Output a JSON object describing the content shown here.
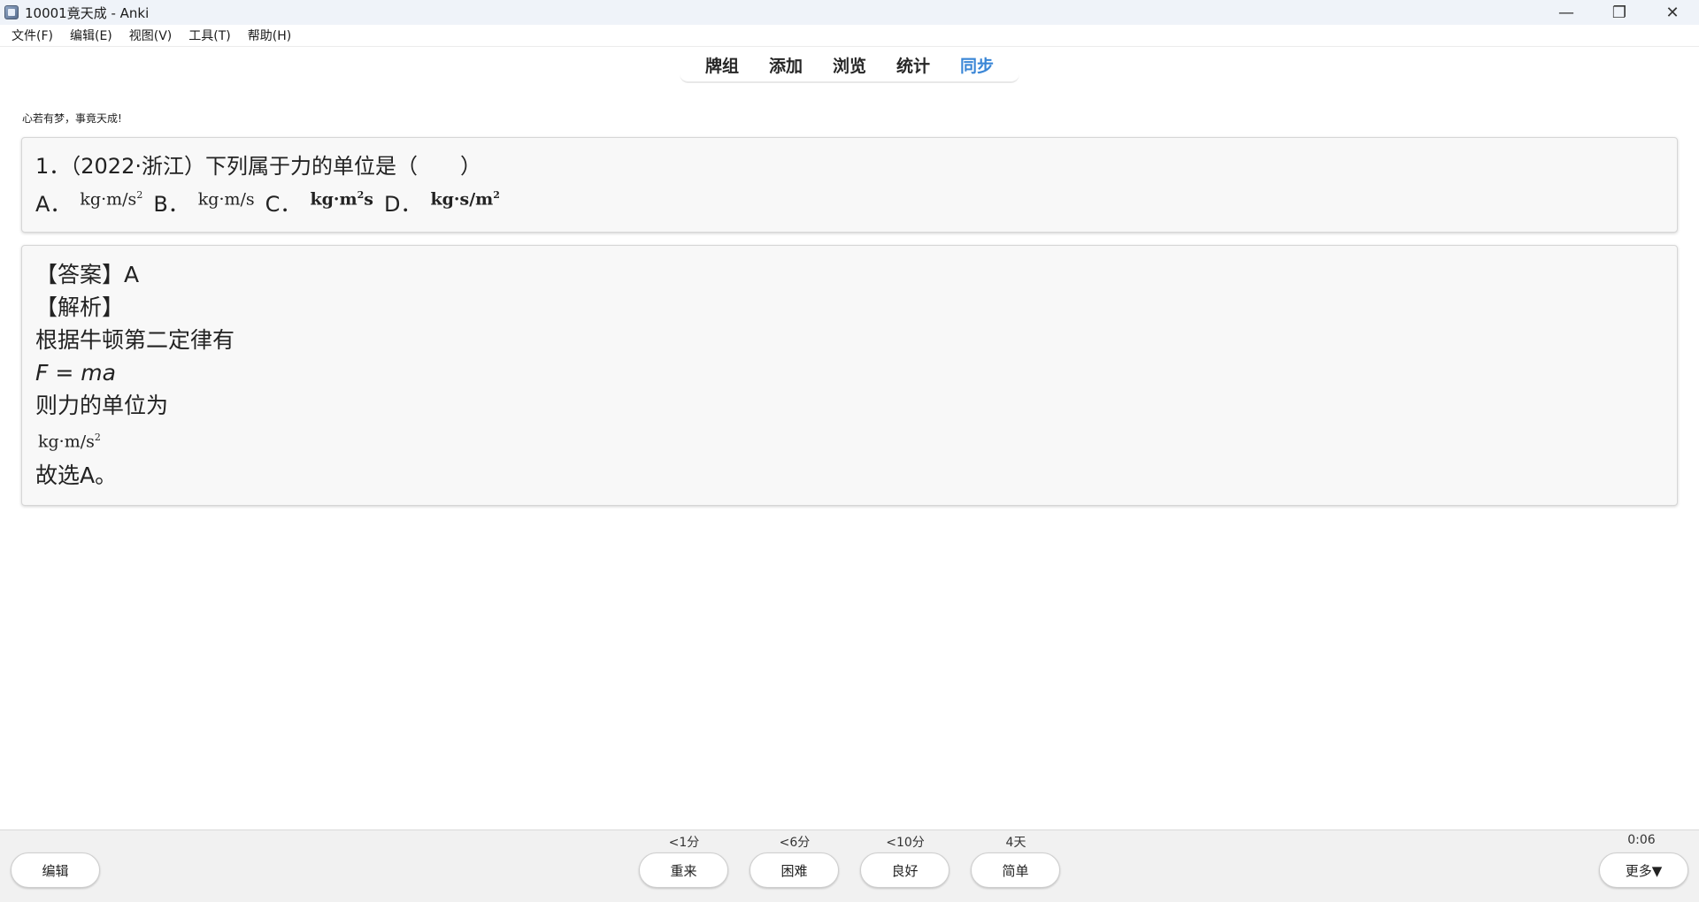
{
  "window": {
    "title": "10001竟天成 - Anki",
    "minimize": "—",
    "restore": "❐",
    "close": "✕"
  },
  "menu": [
    "文件(F)",
    "编辑(E)",
    "视图(V)",
    "工具(T)",
    "帮助(H)"
  ],
  "nav": [
    "牌组",
    "添加",
    "浏览",
    "统计",
    "同步"
  ],
  "nav_active": "同步",
  "motto": "心若有梦，事竟天成!",
  "question": {
    "stem": "1．（2022·浙江）下列属于力的单位是（　　）",
    "options": [
      {
        "label": "A．",
        "formula_base": "kg·m/s",
        "formula_sup": "2",
        "formula_tail": "",
        "bold": false
      },
      {
        "label": "B．",
        "formula_base": "kg·m/s",
        "formula_sup": "",
        "formula_tail": "",
        "bold": false
      },
      {
        "label": "C．",
        "formula_base": "kg·m",
        "formula_sup": "2",
        "formula_tail": "s",
        "bold": true
      },
      {
        "label": "D．",
        "formula_base": "kg·s/m",
        "formula_sup": "2",
        "formula_tail": "",
        "bold": true
      }
    ]
  },
  "answer": {
    "answer_line": "【答案】A",
    "analysis_heading": "【解析】",
    "line1": "根据牛顿第二定律有",
    "equation": "F = ma",
    "line2": "则力的单位为",
    "unit_base": "kg·m/s",
    "unit_sup": "2",
    "conclusion": "故选A。"
  },
  "bottom": {
    "edit": "编辑",
    "more": "更多▼",
    "timer": "0:06",
    "buttons": [
      {
        "label": "重来",
        "interval": "<1分"
      },
      {
        "label": "困难",
        "interval": "<6分"
      },
      {
        "label": "良好",
        "interval": "<10分"
      },
      {
        "label": "简单",
        "interval": "4天"
      }
    ]
  }
}
